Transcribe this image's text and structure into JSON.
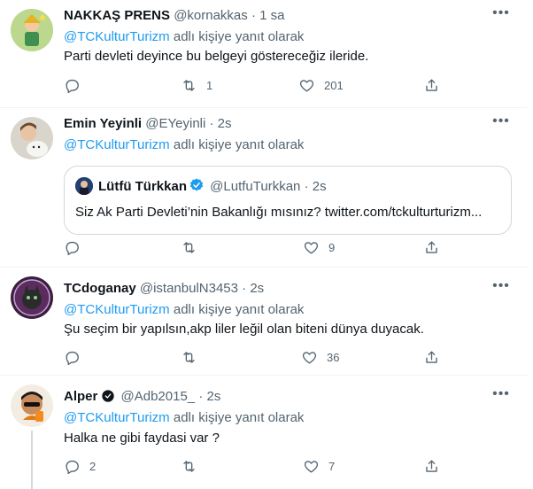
{
  "tweets": [
    {
      "name": "NAKKAŞ PRENS",
      "handle": "@kornakkas",
      "time": "· 1 sa",
      "reply_to_mention": "@TCKulturTurizm",
      "reply_suffix": " adlı kişiye yanıt olarak",
      "text": "Parti devleti deyince bu belgeyi göstereceğiz ileride.",
      "replies": "",
      "retweets": "1",
      "likes": "201"
    },
    {
      "name": "Emin Yeyinli",
      "handle": "@EYeyinli",
      "time": "· 2s",
      "reply_to_mention": "@TCKulturTurizm",
      "reply_suffix": " adlı kişiye yanıt olarak",
      "quote": {
        "name": "Lütfü Türkkan",
        "handle": "@LutfuTurkkan",
        "time": "· 2s",
        "text": "Siz Ak Parti Devleti’nin Bakanlığı mısınız? twitter.com/tckulturturizm..."
      },
      "replies": "",
      "retweets": "",
      "likes": "9"
    },
    {
      "name": "TCdoganay",
      "handle": "@istanbulN3453",
      "time": "· 2s",
      "reply_to_mention": "@TCKulturTurizm",
      "reply_suffix": " adlı kişiye yanıt olarak",
      "text": "Şu seçim bir yapılsın,akp liler leğil olan biteni dünya duyacak.",
      "replies": "",
      "retweets": "",
      "likes": "36"
    },
    {
      "name": "Alper",
      "handle": "@Adb2015_",
      "time": "· 2s",
      "reply_to_mention": "@TCKulturTurizm",
      "reply_suffix": " adlı kişiye yanıt olarak",
      "text": "Halka ne gibi faydasi var ?",
      "replies": "2",
      "retweets": "",
      "likes": "7"
    }
  ],
  "colors": {
    "accent": "#1d9bf0",
    "muted": "#536471",
    "border": "#eff3f4"
  },
  "icons": [
    "reply-icon",
    "retweet-icon",
    "like-icon",
    "share-icon",
    "more-icon",
    "verified-icon"
  ]
}
